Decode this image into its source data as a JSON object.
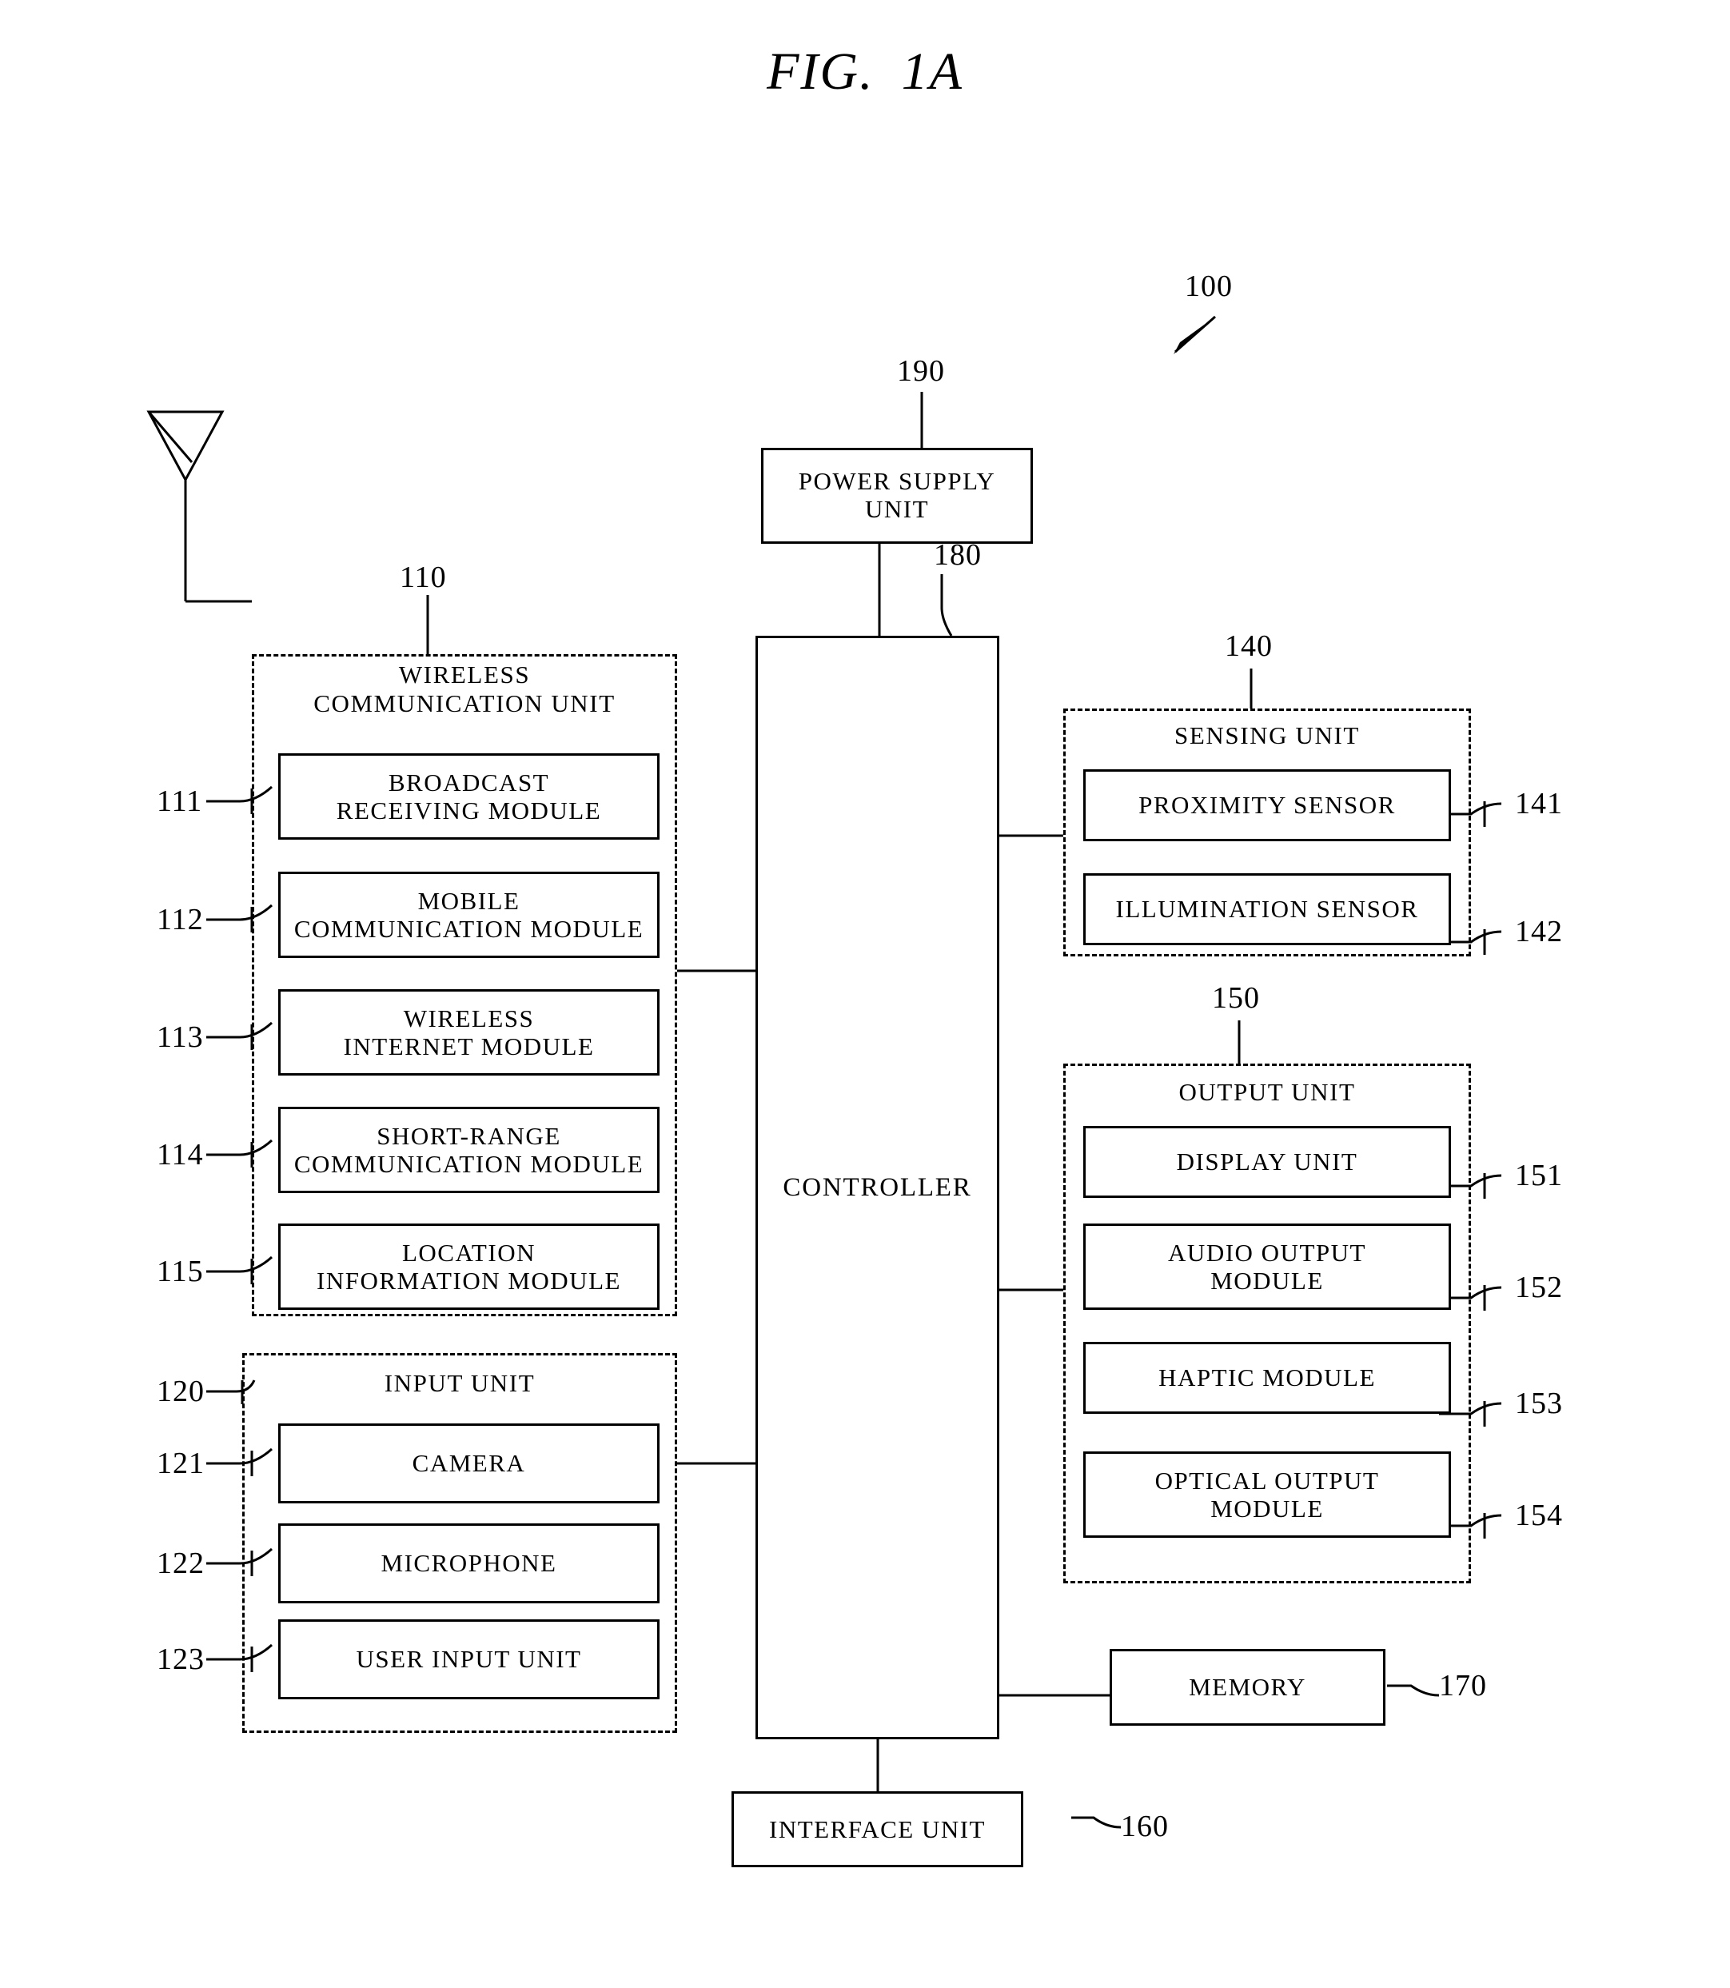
{
  "figure": {
    "title_main": "FIG.",
    "title_number": "1A",
    "device_ref": "100"
  },
  "power_supply": {
    "label": "POWER SUPPLY\nUNIT",
    "ref": "190"
  },
  "controller": {
    "label": "CONTROLLER",
    "ref": "180"
  },
  "wireless_unit": {
    "title": "WIRELESS\nCOMMUNICATION UNIT",
    "ref": "110",
    "modules": [
      {
        "label": "BROADCAST\nRECEIVING MODULE",
        "ref": "111"
      },
      {
        "label": "MOBILE\nCOMMUNICATION MODULE",
        "ref": "112"
      },
      {
        "label": "WIRELESS\nINTERNET MODULE",
        "ref": "113"
      },
      {
        "label": "SHORT-RANGE\nCOMMUNICATION MODULE",
        "ref": "114"
      },
      {
        "label": "LOCATION\nINFORMATION MODULE",
        "ref": "115"
      }
    ]
  },
  "input_unit": {
    "title": "INPUT UNIT",
    "ref": "120",
    "modules": [
      {
        "label": "CAMERA",
        "ref": "121"
      },
      {
        "label": "MICROPHONE",
        "ref": "122"
      },
      {
        "label": "USER INPUT UNIT",
        "ref": "123"
      }
    ]
  },
  "sensing_unit": {
    "title": "SENSING UNIT",
    "ref": "140",
    "modules": [
      {
        "label": "PROXIMITY SENSOR",
        "ref": "141"
      },
      {
        "label": "ILLUMINATION SENSOR",
        "ref": "142"
      }
    ]
  },
  "output_unit": {
    "title": "OUTPUT UNIT",
    "ref": "150",
    "modules": [
      {
        "label": "DISPLAY UNIT",
        "ref": "151"
      },
      {
        "label": "AUDIO OUTPUT\nMODULE",
        "ref": "152"
      },
      {
        "label": "HAPTIC MODULE",
        "ref": "153"
      },
      {
        "label": "OPTICAL OUTPUT\nMODULE",
        "ref": "154"
      }
    ]
  },
  "memory": {
    "label": "MEMORY",
    "ref": "170"
  },
  "interface_unit": {
    "label": "INTERFACE UNIT",
    "ref": "160"
  },
  "antenna": {
    "name": "antenna-symbol"
  },
  "colors": {
    "ink": "#000000",
    "paper": "#ffffff"
  }
}
